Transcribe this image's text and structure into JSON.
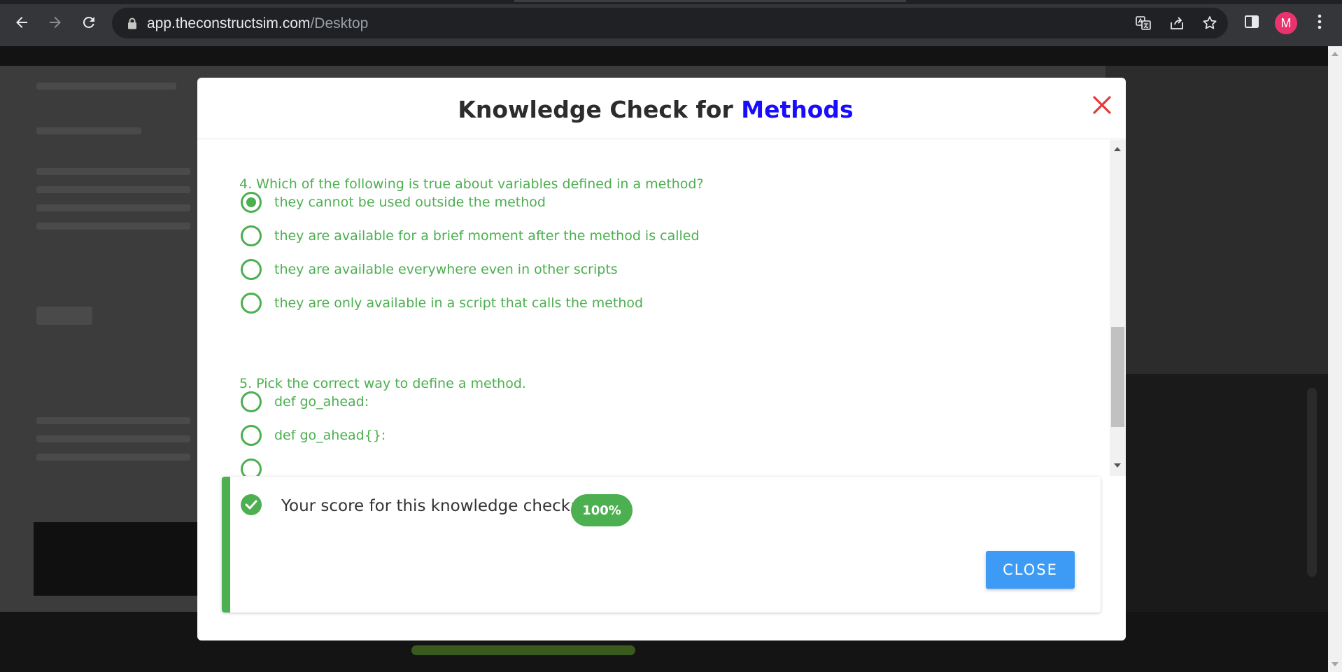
{
  "browser": {
    "url_host": "app.theconstructsim.com",
    "url_path": "/Desktop",
    "profile_initial": "M",
    "icons": [
      "back-icon",
      "forward-icon",
      "reload-icon",
      "lock-icon",
      "translate-icon",
      "share-icon",
      "bookmark-star-icon",
      "side-panel-icon",
      "more-vert-icon"
    ]
  },
  "modal": {
    "title_prefix": "Knowledge Check for ",
    "title_topic": "Methods",
    "questions": [
      {
        "text": "4. Which of the following is true about variables defined in a method?",
        "options": [
          {
            "label": "they cannot be used outside the method",
            "selected": true
          },
          {
            "label": "they are available for a brief moment after the method is called",
            "selected": false
          },
          {
            "label": "they are available everywhere even in other scripts",
            "selected": false
          },
          {
            "label": "they are only available in a script that calls the method",
            "selected": false
          }
        ]
      },
      {
        "text": "5. Pick the correct way to define a method.",
        "options": [
          {
            "label": "def go_ahead:",
            "selected": false
          },
          {
            "label": "def go_ahead{}:",
            "selected": false
          }
        ]
      }
    ],
    "result": {
      "score_label": "Your score for this knowledge check:",
      "score_value": "100%",
      "close_label": "CLOSE"
    }
  },
  "colors": {
    "accent_topic": "#1a0dff",
    "success_green": "#4caf50",
    "close_x_red": "#e53935",
    "close_button_blue": "#3d9bf5"
  }
}
